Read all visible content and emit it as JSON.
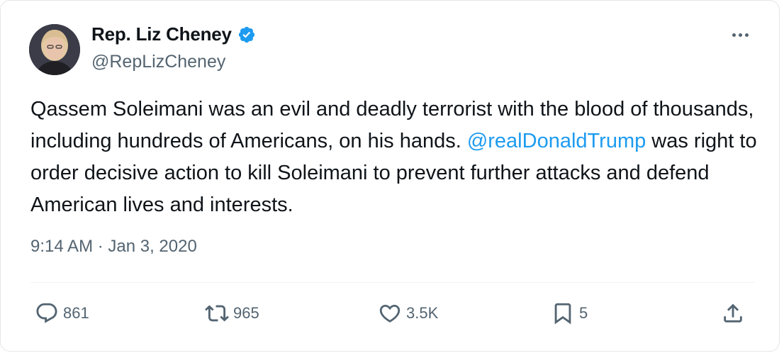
{
  "author": {
    "name": "Rep. Liz Cheney",
    "handle": "@RepLizCheney",
    "verified_icon": "verified-badge-icon",
    "avatar_icon": "profile-avatar"
  },
  "tweet": {
    "text_part1": "Qassem Soleimani was an evil and deadly terrorist with the blood of thousands, including hundreds of Americans, on his hands. ",
    "mention": "@realDonaldTrump",
    "text_part2": " was right to order decisive action to kill Soleimani to prevent further attacks and defend American lives and interests.",
    "timestamp": "9:14 AM · Jan 3, 2020"
  },
  "actions": {
    "replies": "861",
    "retweets": "965",
    "likes": "3.5K",
    "bookmarks": "5"
  },
  "colors": {
    "accent": "#1d9bf0",
    "secondary_text": "#536471"
  }
}
